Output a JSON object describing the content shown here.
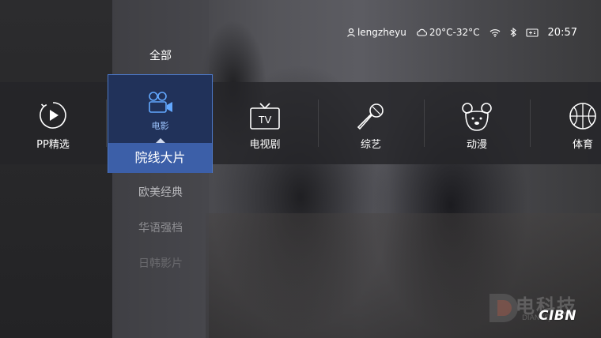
{
  "status": {
    "username": "lengzheyu",
    "weather": "20°C-32°C",
    "time": "20:57"
  },
  "menu": {
    "all_label": "全部",
    "selected": {
      "label": "电影",
      "sub_label": "院线大片"
    },
    "sub_items": [
      "欧美经典",
      "华语强档",
      "日韩影片"
    ]
  },
  "categories": [
    {
      "label": "PP精选",
      "icon": "play-circle-icon"
    },
    {
      "label": "电视剧",
      "icon": "tv-icon"
    },
    {
      "label": "综艺",
      "icon": "microphone-icon"
    },
    {
      "label": "动漫",
      "icon": "cartoon-bear-icon"
    },
    {
      "label": "体育",
      "icon": "basketball-icon"
    }
  ],
  "watermark": {
    "text": "电科技",
    "sub": "DIANKEJI",
    "brand": "CIBN"
  },
  "colors": {
    "selected_card": "#21325a",
    "selected_border": "#4c78c8",
    "selected_sub": "#3c5fa8",
    "selected_label": "#9cc4ff"
  }
}
